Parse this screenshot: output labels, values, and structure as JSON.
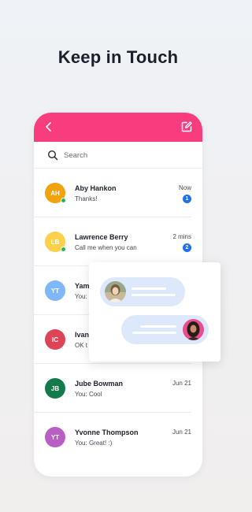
{
  "headline": "Keep in Touch",
  "colors": {
    "accent": "#f83c7e",
    "online": "#25b55b",
    "badge": "#1f6ff0",
    "bubble": "#dde9fb"
  },
  "search": {
    "placeholder": "Search"
  },
  "conversations": [
    {
      "initials": "AH",
      "name": "Aby Hankon",
      "preview": "Thanks!",
      "time": "Now",
      "unread": "1",
      "online": true,
      "color": "#f2a20c"
    },
    {
      "initials": "LB",
      "name": "Lawrence Berry",
      "preview": "Call me when you can",
      "time": "2 mins",
      "unread": "2",
      "online": true,
      "color": "#fbd14b"
    },
    {
      "initials": "YT",
      "name": "Yam",
      "preview": "You:",
      "time": "",
      "unread": "",
      "online": false,
      "color": "#7fb7f8"
    },
    {
      "initials": "IC",
      "name": "Ivan",
      "preview": "OK t",
      "time": "",
      "unread": "",
      "online": false,
      "color": "#dd4556"
    },
    {
      "initials": "JB",
      "name": "Jube Bowman",
      "preview": "You: Cool",
      "time": "Jun 21",
      "unread": "",
      "online": false,
      "color": "#137a4b"
    },
    {
      "initials": "YT",
      "name": "Yvonne Thompson",
      "preview": "You: Great! :)",
      "time": "Jun 21",
      "unread": "",
      "online": false,
      "color": "#b95ec4"
    }
  ],
  "icons": {
    "back": "chevron-left-icon",
    "compose": "compose-icon",
    "search": "search-icon"
  }
}
